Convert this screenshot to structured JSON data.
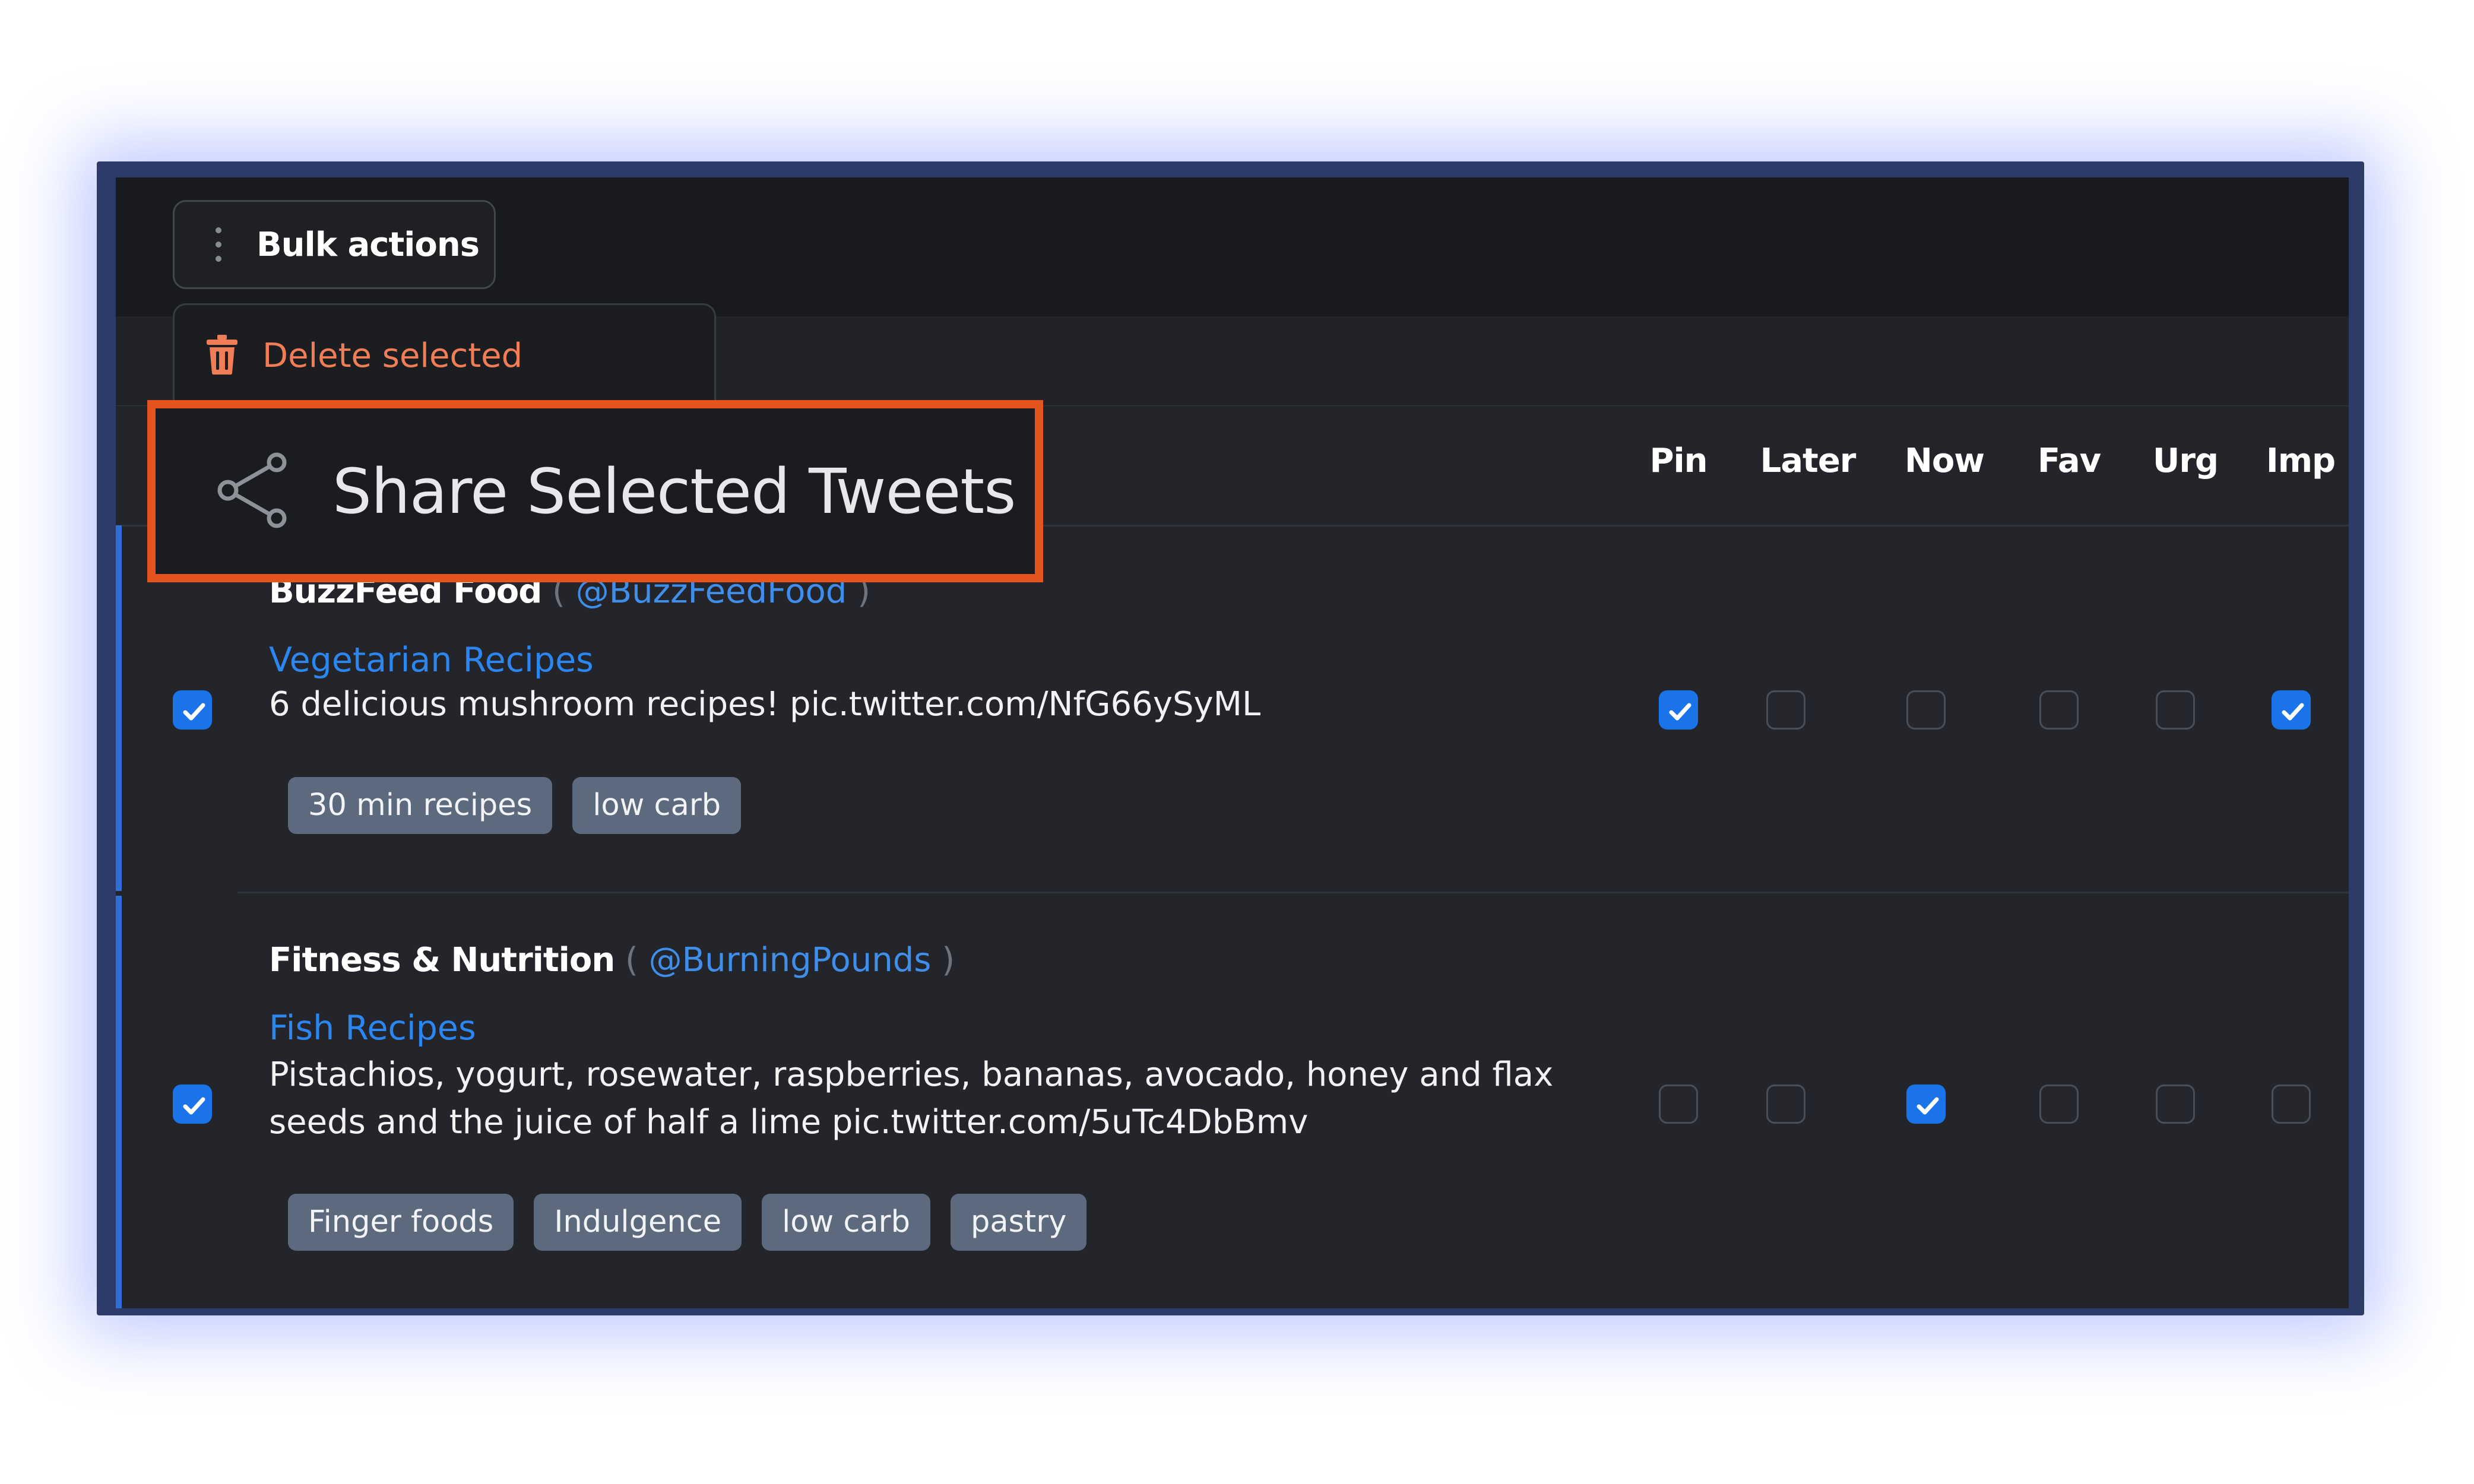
{
  "toolbar": {
    "bulk_actions_label": "Bulk actions"
  },
  "menu": {
    "delete_label": "Delete selected",
    "share_label": "Share Selected Tweets"
  },
  "columns": [
    "Pin",
    "Later",
    "Now",
    "Fav",
    "Urg",
    "Imp"
  ],
  "rows": [
    {
      "author": "BuzzFeed Food",
      "handle": "@BuzzFeedFood",
      "category": "Vegetarian Recipes",
      "text": "6 delicious mushroom recipes! pic.twitter.com/NfG66ySyML",
      "tags": [
        "30 min recipes",
        "low carb"
      ],
      "selected": true,
      "flags": {
        "Pin": true,
        "Later": false,
        "Now": false,
        "Fav": false,
        "Urg": false,
        "Imp": true
      }
    },
    {
      "author": "Fitness & Nutrition",
      "handle": "@BurningPounds",
      "category": "Fish Recipes",
      "text": "Pistachios, yogurt, rosewater, raspberries, bananas, avocado, honey and flax seeds and the juice of half a lime pic.twitter.com/5uTc4DbBmv",
      "tags": [
        "Finger foods",
        "Indulgence",
        "low carb",
        "pastry"
      ],
      "selected": true,
      "flags": {
        "Pin": false,
        "Later": false,
        "Now": true,
        "Fav": false,
        "Urg": false,
        "Imp": false
      }
    }
  ],
  "paren_open": "(",
  "paren_close": ")",
  "icons": {
    "bulk": "kebab-menu-icon",
    "delete": "trash-icon",
    "share": "share-icon",
    "check": "checkmark-icon"
  },
  "colors": {
    "accent_blue": "#1a73e8",
    "delete_orange": "#f07d55",
    "highlight_border": "#e4541f"
  }
}
